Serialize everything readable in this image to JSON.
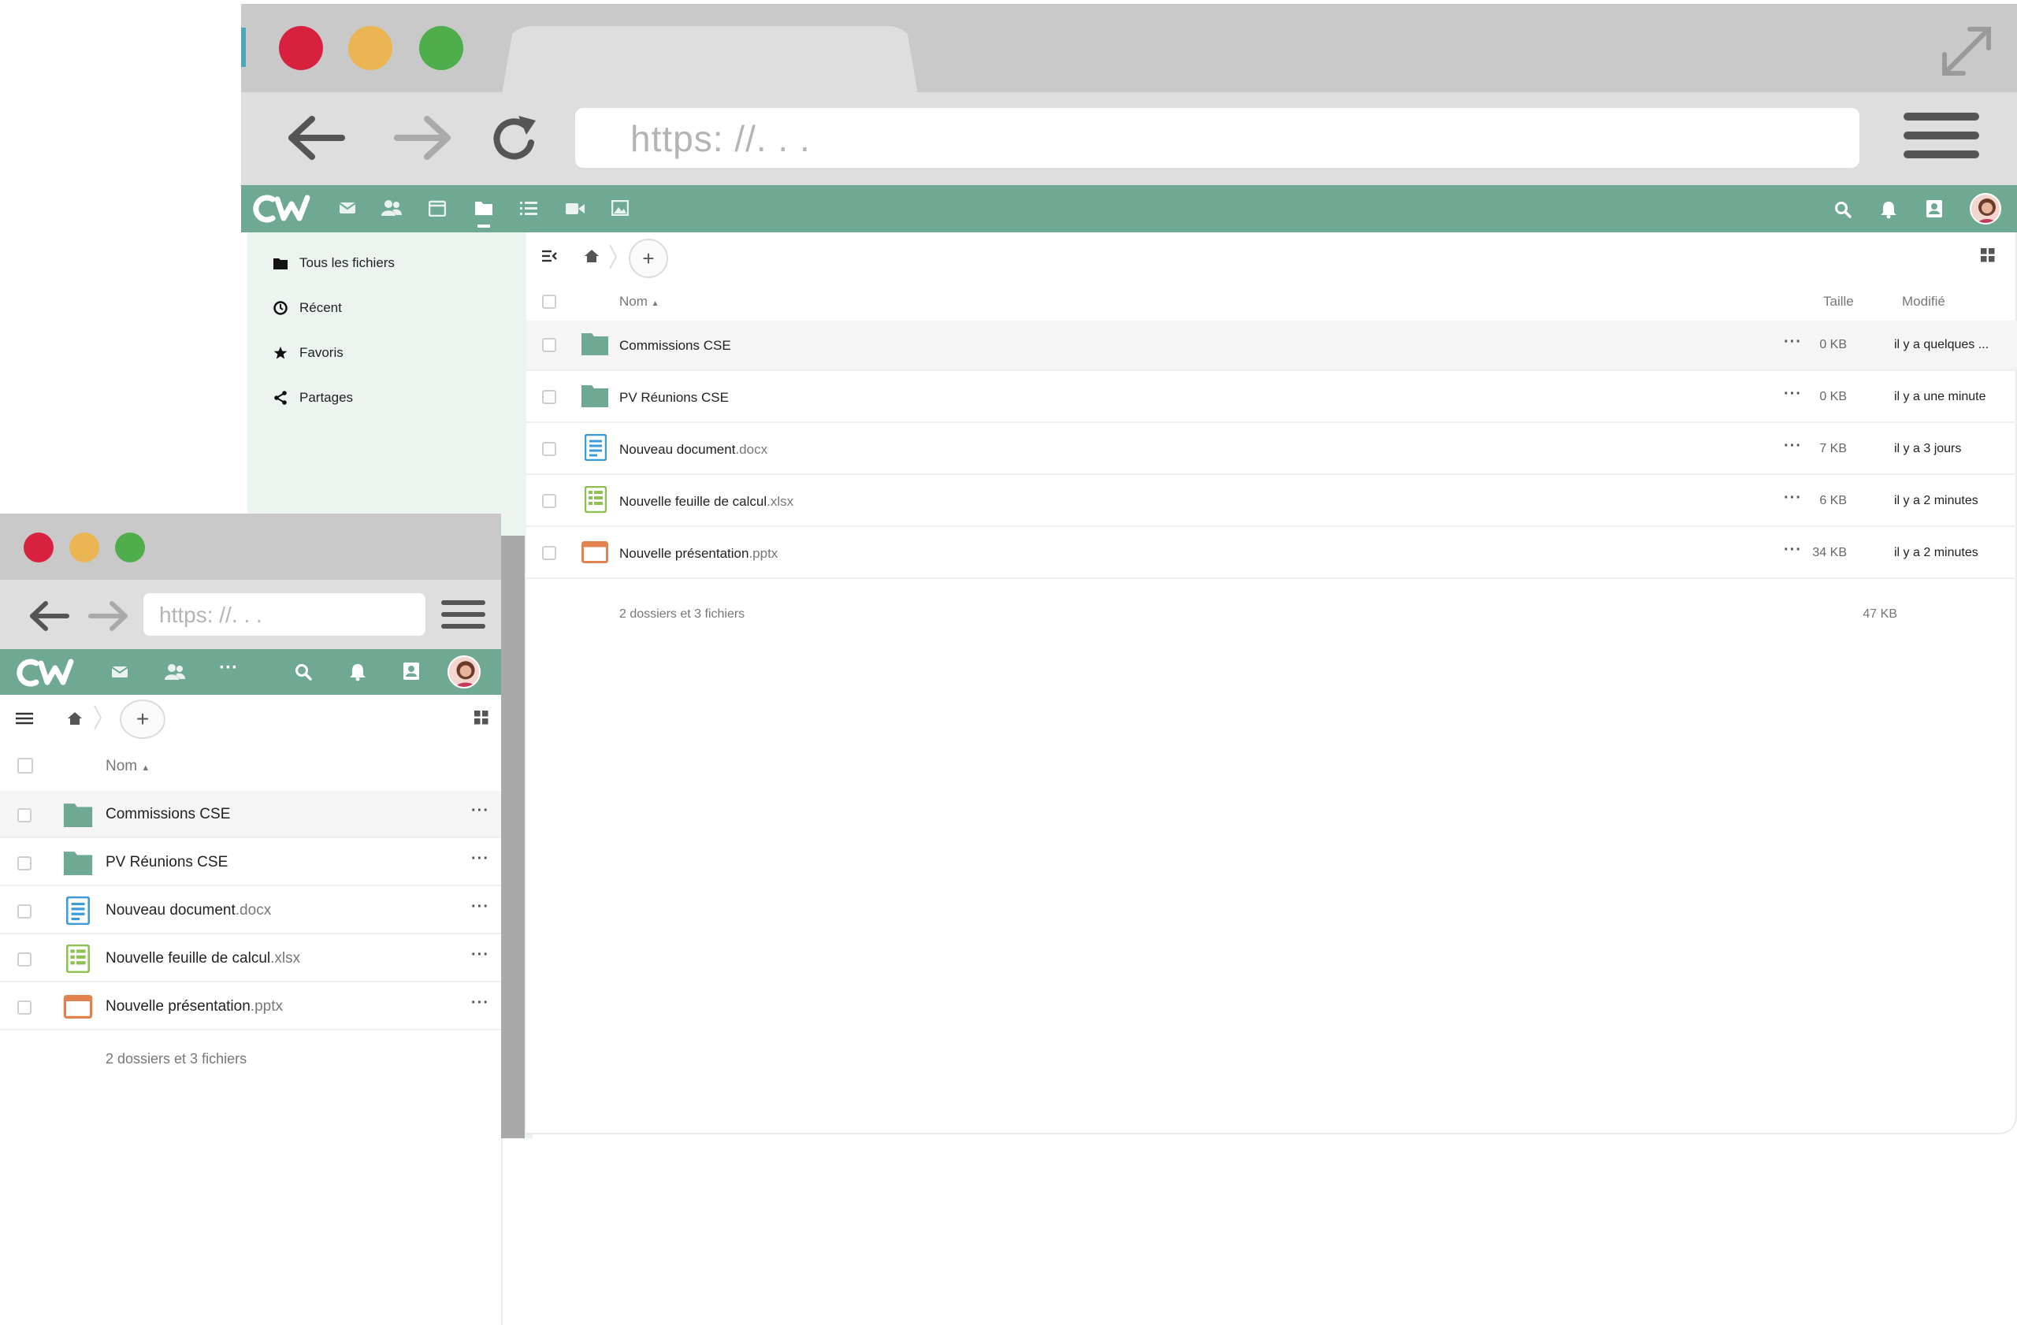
{
  "big_browser": {
    "url_placeholder": "https: //. . .",
    "sidebar": [
      {
        "label": "Tous les fichiers",
        "icon": "folder-icon"
      },
      {
        "label": "Récent",
        "icon": "clock-icon"
      },
      {
        "label": "Favoris",
        "icon": "star-icon"
      },
      {
        "label": "Partages",
        "icon": "share-icon"
      }
    ],
    "table_header": {
      "name": "Nom",
      "size": "Taille",
      "modified": "Modifié"
    },
    "files": [
      {
        "name": "Commissions CSE",
        "ext": "",
        "type": "folder",
        "size": "0 KB",
        "modified": "il y a quelques ..."
      },
      {
        "name": "PV Réunions CSE",
        "ext": "",
        "type": "folder",
        "size": "0 KB",
        "modified": "il y a une minute"
      },
      {
        "name": "Nouveau document",
        "ext": ".docx",
        "type": "document",
        "size": "7 KB",
        "modified": "il y a 3 jours"
      },
      {
        "name": "Nouvelle feuille de calcul",
        "ext": ".xlsx",
        "type": "spreadsheet",
        "size": "6 KB",
        "modified": "il y a 2 minutes"
      },
      {
        "name": "Nouvelle présentation",
        "ext": ".pptx",
        "type": "presentation",
        "size": "34 KB",
        "modified": "il y a 2 minutes"
      }
    ],
    "summary": "2 dossiers et 3 fichiers",
    "total_size": "47 KB"
  },
  "small_browser": {
    "url_placeholder": "https: //. . .",
    "table_header": {
      "name": "Nom"
    },
    "files": [
      {
        "name": "Commissions CSE",
        "ext": ""
      },
      {
        "name": "PV Réunions CSE",
        "ext": ""
      },
      {
        "name": "Nouveau document",
        "ext": ".docx"
      },
      {
        "name": "Nouvelle feuille de calcul",
        "ext": ".xlsx"
      },
      {
        "name": "Nouvelle présentation",
        "ext": ".pptx"
      }
    ],
    "summary": "2 dossiers et 3 fichiers"
  },
  "colors": {
    "appbar": "#6fa993",
    "sidebar_bg": "#ecf4f0",
    "close_dot": "#d8203f",
    "minimize_dot": "#eab552",
    "maximize_dot": "#4fae4c",
    "folder": "#6fa993",
    "document": "#3d9bd8",
    "spreadsheet": "#8dc152",
    "presentation": "#e2834f"
  },
  "icons": [
    "mail-icon",
    "contacts-icon",
    "calendar-icon",
    "files-icon",
    "tasks-icon",
    "video-icon",
    "gallery-icon",
    "search-icon",
    "bell-icon",
    "address-book-icon",
    "avatar"
  ]
}
